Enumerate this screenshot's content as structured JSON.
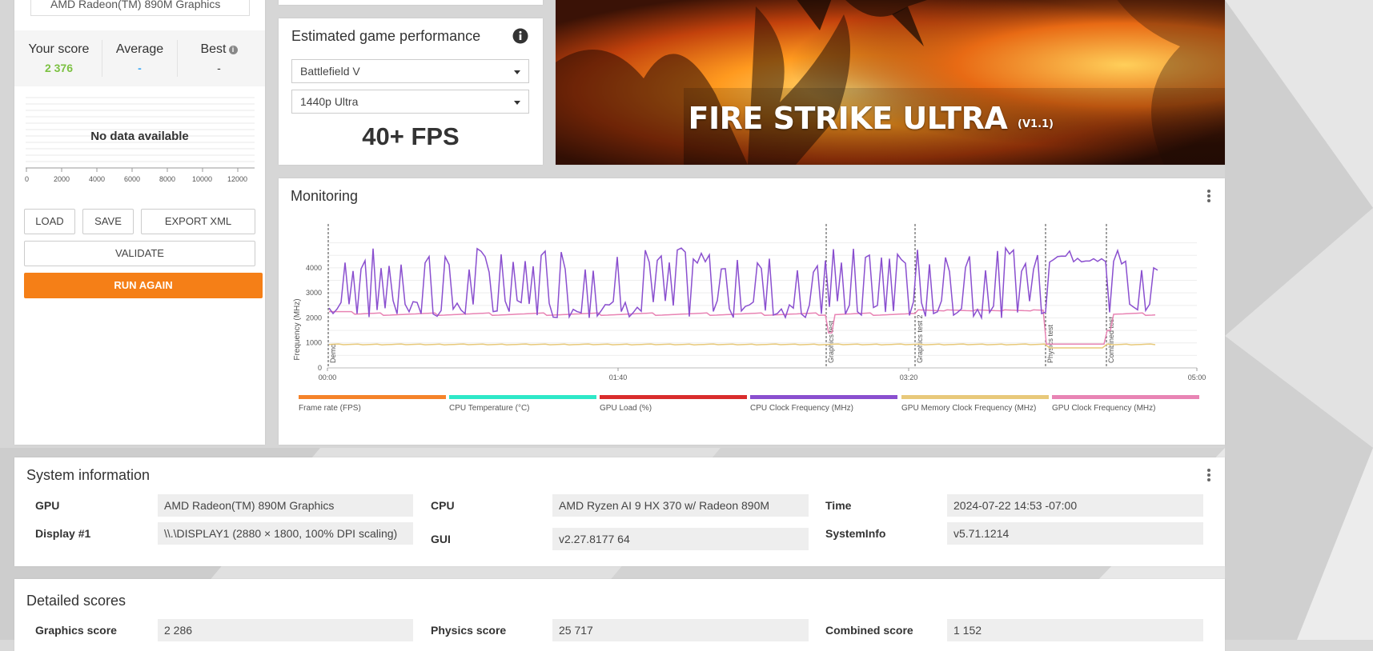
{
  "left_panel": {
    "gpu_name": "AMD Radeon(TM) 890M Graphics",
    "your_score_label": "Your score",
    "your_score_value": "2 376",
    "average_label": "Average",
    "average_value": "-",
    "best_label": "Best",
    "best_value": "-",
    "no_data": "No data available",
    "axis_ticks": [
      "0",
      "2000",
      "4000",
      "6000",
      "8000",
      "10000",
      "12000"
    ],
    "load_label": "LOAD",
    "save_label": "SAVE",
    "export_label": "EXPORT XML",
    "validate_label": "VALIDATE",
    "run_again_label": "RUN AGAIN"
  },
  "estimated": {
    "title": "Estimated game performance",
    "game": "Battlefield V",
    "preset": "1440p Ultra",
    "fps": "40+ FPS"
  },
  "hero": {
    "title": "FIRE STRIKE ULTRA",
    "version": "(V1.1)"
  },
  "monitoring": {
    "title": "Monitoring",
    "y_axis_label": "Frequency (MHz)",
    "y_ticks": [
      "0",
      "1000",
      "2000",
      "3000",
      "4000"
    ],
    "x_ticks": [
      "00:00",
      "01:40",
      "03:20",
      "05:00"
    ],
    "markers": [
      "Demo",
      "Graphics test",
      "Graphics test 2",
      "Physics test",
      "Combined test"
    ],
    "legend": [
      {
        "label": "Frame rate (FPS)",
        "color": "#f5832a"
      },
      {
        "label": "CPU Temperature (°C)",
        "color": "#2ee8c8"
      },
      {
        "label": "GPU Load (%)",
        "color": "#d92c2c"
      },
      {
        "label": "CPU Clock Frequency (MHz)",
        "color": "#8a4fcf"
      },
      {
        "label": "GPU Memory Clock Frequency (MHz)",
        "color": "#e8c97a"
      },
      {
        "label": "GPU Clock Frequency (MHz)",
        "color": "#e884b4"
      }
    ]
  },
  "system_info": {
    "title": "System information",
    "gpu_label": "GPU",
    "gpu_value": "AMD Radeon(TM) 890M Graphics",
    "display_label": "Display #1",
    "display_value": "\\\\.\\DISPLAY1 (2880 × 1800, 100% DPI scaling)",
    "cpu_label": "CPU",
    "cpu_value": "AMD Ryzen AI 9 HX 370 w/ Radeon 890M",
    "gui_label": "GUI",
    "gui_value": "v2.27.8177 64",
    "time_label": "Time",
    "time_value": "2024-07-22 14:53 -07:00",
    "sysinfo_label": "SystemInfo",
    "sysinfo_value": "v5.71.1214"
  },
  "detailed": {
    "title": "Detailed scores",
    "graphics_label": "Graphics score",
    "graphics_value": "2 286",
    "physics_label": "Physics score",
    "physics_value": "25 717",
    "combined_label": "Combined score",
    "combined_value": "1 152"
  },
  "colors": {
    "accent": "#f57f17",
    "score_green": "#7cc142",
    "average_blue": "#3fa9f5"
  }
}
